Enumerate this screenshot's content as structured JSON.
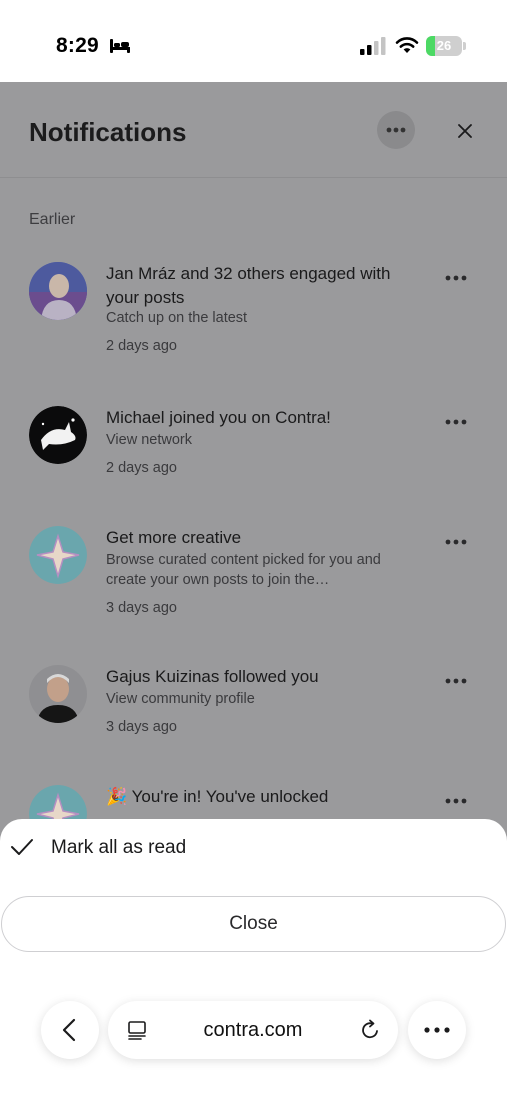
{
  "status_bar": {
    "time": "8:29",
    "battery_level": "26",
    "battery_fraction": 0.26,
    "icons": [
      "bed-icon",
      "signal-icon",
      "wifi-icon",
      "battery-icon"
    ]
  },
  "page": {
    "title": "Notifications",
    "section_label": "Earlier"
  },
  "notifications": [
    {
      "title": "Jan Mráz and 32 others engaged with your posts",
      "subtitle": "Catch up on the latest",
      "time": "2 days ago",
      "avatar": "person-avatar"
    },
    {
      "title": "Michael joined you on Contra!",
      "subtitle": "View network",
      "time": "2 days ago",
      "avatar": "shark-avatar"
    },
    {
      "title": "Get more creative",
      "subtitle": "Browse curated content picked for you and create your own posts to join the…",
      "time": "3 days ago",
      "avatar": "contra-star-avatar"
    },
    {
      "title": "Gajus Kuizinas followed you",
      "subtitle": "View community profile",
      "time": "3 days ago",
      "avatar": "person-avatar"
    },
    {
      "title": "🎉 You're in! You've unlocked",
      "avatar": "contra-star-avatar"
    }
  ],
  "sheet": {
    "mark_all_label": "Mark all as read",
    "close_label": "Close"
  },
  "browser": {
    "url": "contra.com"
  },
  "colors": {
    "overlay": "#9a9a9c",
    "battery_green": "#4cd964"
  }
}
